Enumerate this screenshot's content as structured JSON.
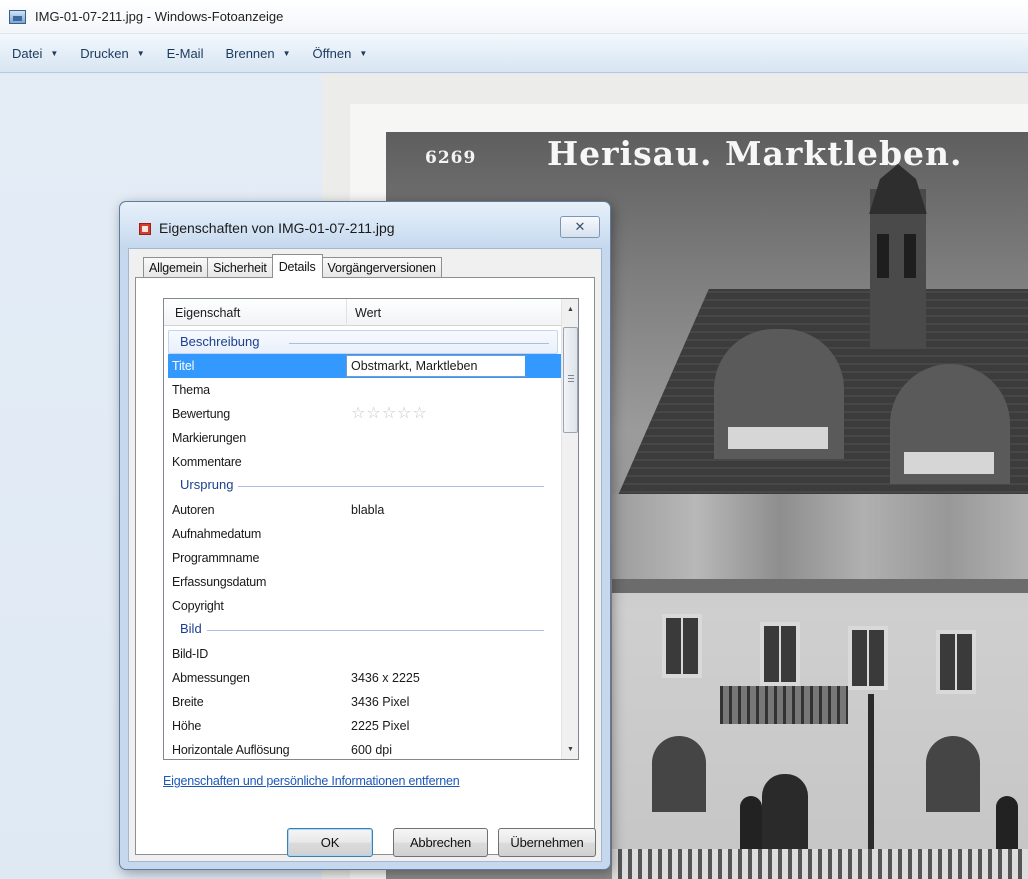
{
  "window": {
    "title": "IMG-01-07-211.jpg - Windows-Fotoanzeige"
  },
  "menu": [
    {
      "label": "Datei",
      "has_dropdown": true
    },
    {
      "label": "Drucken",
      "has_dropdown": true
    },
    {
      "label": "E-Mail",
      "has_dropdown": false
    },
    {
      "label": "Brennen",
      "has_dropdown": true
    },
    {
      "label": "Öffnen",
      "has_dropdown": true
    }
  ],
  "photo": {
    "number": "6269",
    "caption": "Herisau. Marktleben."
  },
  "dialog": {
    "title": "Eigenschaften von IMG-01-07-211.jpg",
    "close_symbol": "✕",
    "tabs": [
      {
        "label": "Allgemein",
        "active": false
      },
      {
        "label": "Sicherheit",
        "active": false
      },
      {
        "label": "Details",
        "active": true
      },
      {
        "label": "Vorgängerversionen",
        "active": false
      }
    ],
    "columns": {
      "property": "Eigenschaft",
      "value": "Wert"
    },
    "groups": {
      "description": "Beschreibung",
      "origin": "Ursprung",
      "image": "Bild"
    },
    "properties": {
      "title_name": "Titel",
      "title_value": "Obstmarkt, Marktleben",
      "subject": "Thema",
      "rating": "Bewertung",
      "rating_stars_filled": 0,
      "rating_stars_total": 5,
      "tags": "Markierungen",
      "comments": "Kommentare",
      "authors_name": "Autoren",
      "authors_value": "blabla",
      "date_taken": "Aufnahmedatum",
      "program_name": "Programmname",
      "date_acquired": "Erfassungsdatum",
      "copyright": "Copyright",
      "image_id": "Bild-ID",
      "dimensions_name": "Abmessungen",
      "dimensions_value": "3436 x 2225",
      "width_name": "Breite",
      "width_value": "3436 Pixel",
      "height_name": "Höhe",
      "height_value": "2225 Pixel",
      "hres_name": "Horizontale Auflösung",
      "hres_value": "600 dpi"
    },
    "remove_link": "Eigenschaften und persönliche Informationen entfernen",
    "buttons": {
      "ok": "OK",
      "cancel": "Abbrechen",
      "apply": "Übernehmen"
    }
  },
  "icons": [
    "photo-viewer-app-icon",
    "dropdown-arrow-icon",
    "dialog-file-icon",
    "close-icon",
    "star-icon",
    "scroll-up-arrow-icon",
    "scroll-down-arrow-icon"
  ],
  "colors": {
    "selection": "#3399ff",
    "group_heading": "#1e3f8f",
    "link": "#1d57b8"
  }
}
